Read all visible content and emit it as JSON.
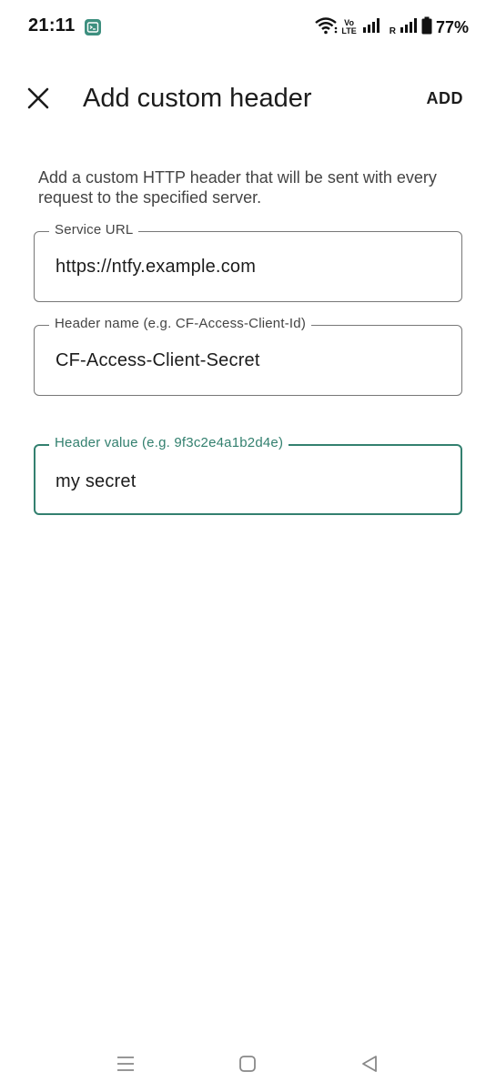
{
  "status_bar": {
    "time": "21:11",
    "notification_icon": "terminal-icon",
    "volte_top": "Vo",
    "volte_bottom": "LTE",
    "roaming": "R",
    "battery_percent": "77%"
  },
  "app_bar": {
    "title": "Add custom header",
    "close_icon": "close-icon",
    "action_label": "ADD"
  },
  "description": "Add a custom HTTP header that will be sent with every request to the specified server.",
  "fields": {
    "service_url": {
      "label": "Service URL",
      "value": "https://ntfy.example.com"
    },
    "header_name": {
      "label": "Header name (e.g. CF-Access-Client-Id)",
      "value": "CF-Access-Client-Secret"
    },
    "header_value": {
      "label": "Header value (e.g. 9f3c2e4a1b2d4e)",
      "value": "my secret",
      "focused": true
    }
  },
  "nav_bar": {
    "icons": [
      "recents-icon",
      "home-icon",
      "back-icon"
    ]
  },
  "colors": {
    "accent": "#33806f",
    "outline": "#777777",
    "text_primary": "#1c1c1c",
    "text_secondary": "#444444",
    "background": "#ffffff"
  }
}
